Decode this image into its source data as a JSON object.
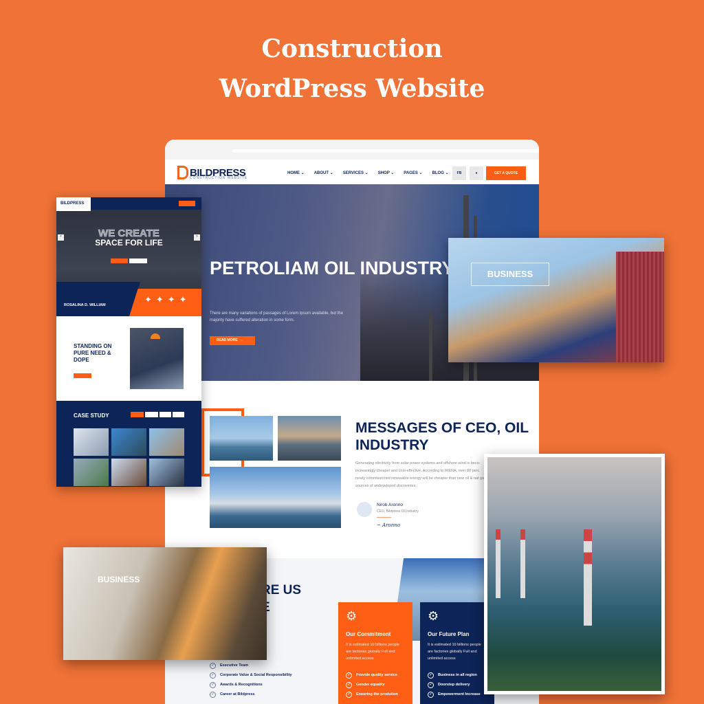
{
  "promo": {
    "title_line1": "Construction",
    "title_line2": "WordPress Website"
  },
  "colors": {
    "background": "#f07236",
    "accent": "#ff5e14",
    "navy": "#0d2459"
  },
  "site": {
    "logo": "BILDPRESS",
    "logo_sub": "CONSTRUCTION WEBSITE",
    "nav": [
      "HOME",
      "ABOUT",
      "SERVICES",
      "SHOP",
      "PAGES",
      "BLOG"
    ],
    "fb_label": "FB",
    "chat_icon": "chat-icon",
    "quote_label": "GET A QUOTE",
    "hero": {
      "title": "PETROLIAM OIL INDUSTRY",
      "text": "There are many variations of passages of Lorem Ipsum available, but the majority have suffered alteration in some form.",
      "button": "READ MORE"
    },
    "business_label": "BUSINESS",
    "ceo": {
      "title": "MESSAGES OF CEO, OIL INDUSTRY",
      "text": "Generating electricity from solar power systems and offshore wind is beco- increasingly cheaper and cost-effective. According to IRENA, over 80 perc newly commissioned renewable energy will be cheaper than new oil & nat gas sources of undeveloped discoveries.",
      "name": "Nirob Aronno",
      "role": "CEO, Bildpress Oil Industry"
    },
    "why": {
      "line1_fragment": "RE US",
      "line2_fragment": "E",
      "checklist": [
        "Executive Team",
        "Corporate Value & Social Responsibility",
        "Awards & Recognitions",
        "Career at Bildpress"
      ]
    },
    "cards": [
      {
        "title": "Our Commitment",
        "text": "It is estimated 10 billions people are factories globally Full and unlimited access",
        "items": [
          "Provide quality service",
          "Gender equality",
          "Ensuring the prodution"
        ]
      },
      {
        "title": "Our Future Plan",
        "text": "It is estimated 10 billions people are factories globally Full and unlimited access",
        "items": [
          "Business in all region",
          "Doorstep delivery",
          "Empowerment Increase"
        ]
      }
    ]
  },
  "mobile": {
    "logo": "BILDPRESS",
    "hero_outline": "WE CREATE",
    "hero_title": "SPACE FOR LIFE",
    "person": "ROSALINA D. WILLIAM",
    "about_title": "STANDING ON PURE NEED & DOPE",
    "case_title": "CASE STUDY"
  },
  "overlay_label": "BUSINESS"
}
